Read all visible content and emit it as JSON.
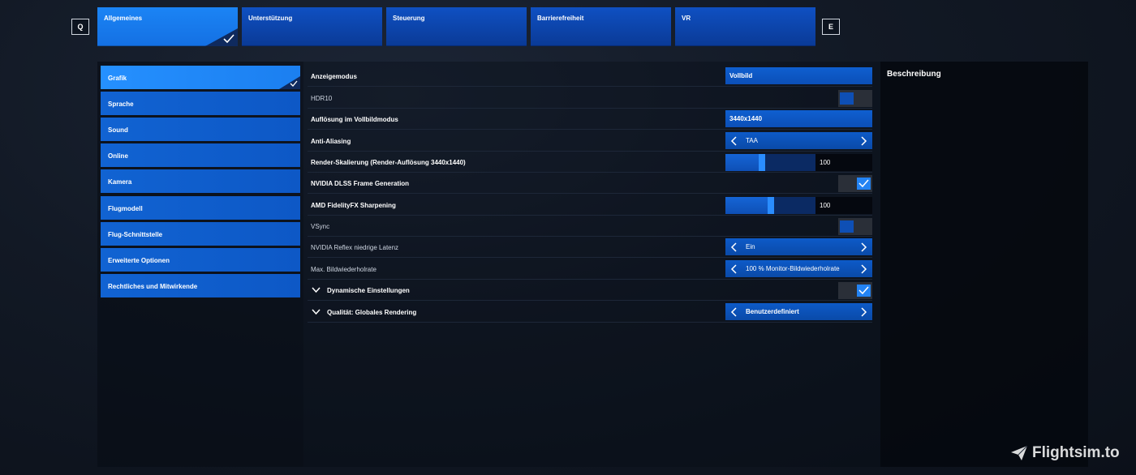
{
  "key_hints": {
    "prev": "Q",
    "next": "E"
  },
  "top_tabs": [
    {
      "label": "Allgemeines",
      "active": true
    },
    {
      "label": "Unterstützung"
    },
    {
      "label": "Steuerung"
    },
    {
      "label": "Barrierefreiheit"
    },
    {
      "label": "VR"
    }
  ],
  "sidebar": {
    "items": [
      {
        "label": "Grafik",
        "active": true
      },
      {
        "label": "Sprache"
      },
      {
        "label": "Sound"
      },
      {
        "label": "Online"
      },
      {
        "label": "Kamera"
      },
      {
        "label": "Flugmodell"
      },
      {
        "label": "Flug-Schnittstelle"
      },
      {
        "label": "Erweiterte Optionen"
      },
      {
        "label": "Rechtliches und Mitwirkende"
      }
    ]
  },
  "settings": {
    "anzeigemodus": {
      "label": "Anzeigemodus",
      "value": "Vollbild"
    },
    "hdr10": {
      "label": "HDR10",
      "enabled": false
    },
    "aufloesung": {
      "label": "Auflösung im Vollbildmodus",
      "value": "3440x1440"
    },
    "anti_aliasing": {
      "label": "Anti-Aliasing",
      "value": "TAA"
    },
    "render_skalierung": {
      "label": "Render-Skalierung (Render-Auflösung 3440x1440)",
      "value": "100",
      "level": 0.4
    },
    "dlss_fg": {
      "label": "NVIDIA DLSS Frame Generation",
      "enabled": true
    },
    "fsr_sharpening": {
      "label": "AMD FidelityFX Sharpening",
      "value": "100",
      "level": 0.5
    },
    "vsync": {
      "label": "VSync",
      "enabled": false
    },
    "reflex": {
      "label": "NVIDIA Reflex niedrige Latenz",
      "value": "Ein"
    },
    "max_refresh": {
      "label": "Max. Bildwiederholrate",
      "value": "100 % Monitor-Bildwiederholrate"
    },
    "dynamische": {
      "label": "Dynamische Einstellungen",
      "enabled": true
    },
    "qualitaet": {
      "label": "Qualität: Globales Rendering",
      "value": "Benutzerdefiniert"
    }
  },
  "description": {
    "title": "Beschreibung"
  },
  "watermark": {
    "text": "Flightsim.to"
  },
  "colors": {
    "accent": "#1b7ff0",
    "active": "#2590ff",
    "panel": "#070b14"
  },
  "icons": {
    "check": "check-icon",
    "chevron_left": "chevron-left-icon",
    "chevron_right": "chevron-right-icon",
    "chevron_down": "chevron-down-icon",
    "plane": "paper-plane-icon"
  }
}
